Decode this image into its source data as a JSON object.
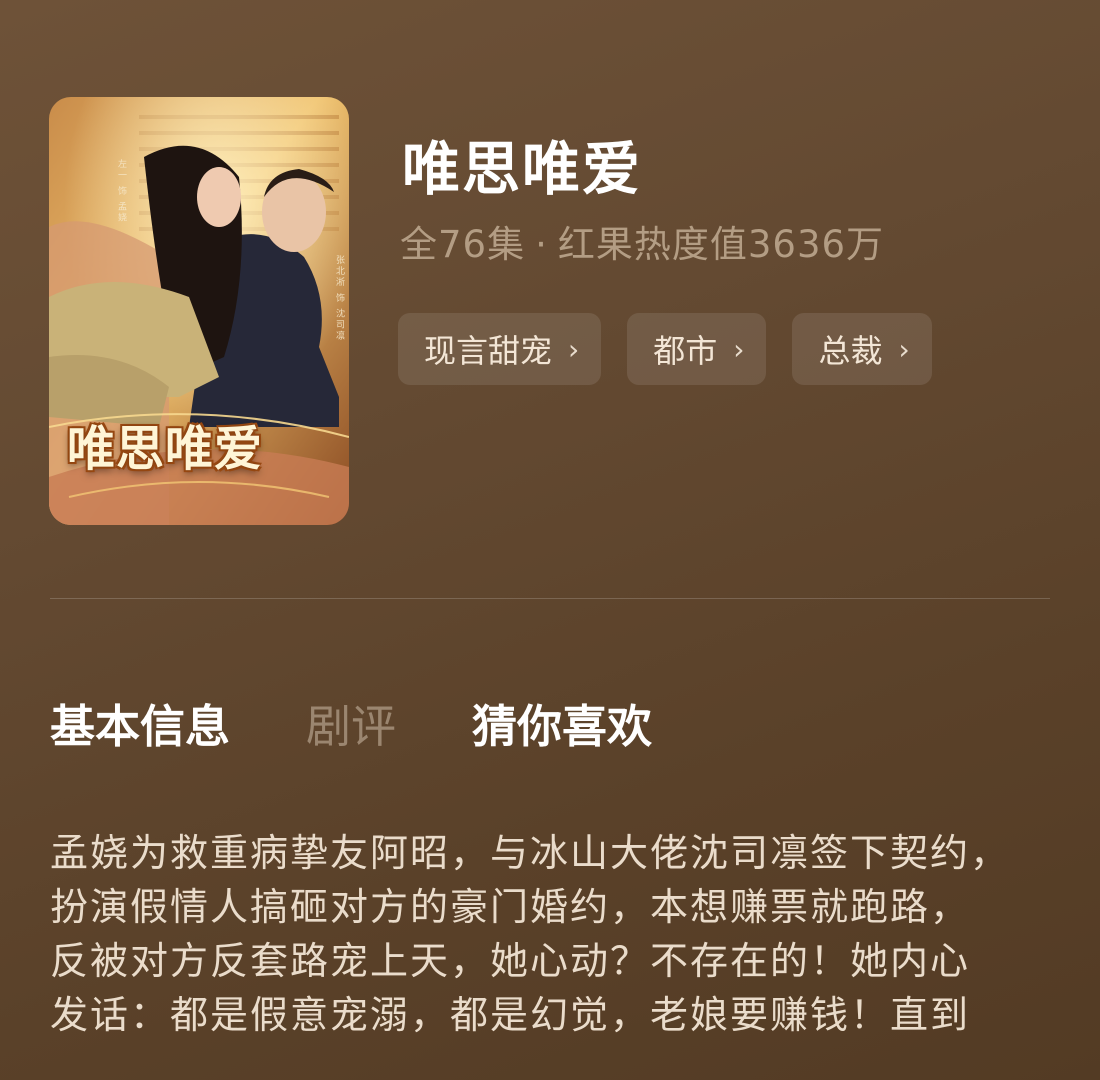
{
  "drama": {
    "cover_title": "唯思唯爱",
    "cover_credits": [
      "左一 饰 孟娆",
      "张北淅 饰 沈司凛"
    ],
    "title": "唯思唯爱",
    "episodes": "全76集",
    "separator": "·",
    "popularity": "红果热度值3636万"
  },
  "tags": [
    {
      "label": "现言甜宠",
      "icon": "chevron-right-icon"
    },
    {
      "label": "都市",
      "icon": "chevron-right-icon"
    },
    {
      "label": "总裁",
      "icon": "chevron-right-icon"
    }
  ],
  "tabs": [
    {
      "label": "基本信息",
      "active": true
    },
    {
      "label": "剧评",
      "active": false
    },
    {
      "label": "猜你喜欢",
      "active": false
    }
  ],
  "description": {
    "lines": [
      "孟娆为救重病挚友阿昭，与冰山大佬沈司凛签下契约，",
      "扮演假情人搞砸对方的豪门婚约，本想赚票就跑路，",
      "反被对方反套路宠上天，她心动？不存在的！她内心",
      "发话：都是假意宠溺，都是幻觉，老娘要赚钱！直到"
    ]
  },
  "colors": {
    "background": "#654a31",
    "tag_bg": "rgba(255,255,255,0.10)",
    "meta_text": "#b39d84",
    "cover_title": "#fff5d6"
  }
}
